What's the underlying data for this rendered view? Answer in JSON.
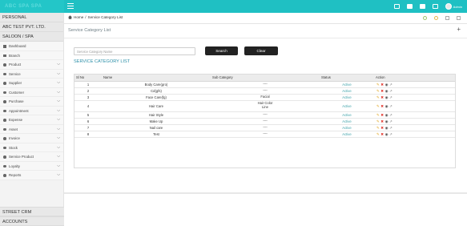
{
  "topbar": {
    "brand": "ABC SPA SPA",
    "user_name": "Admin",
    "icons": [
      "card-icon",
      "chat-icon",
      "bell-icon",
      "user-icon"
    ]
  },
  "sidebar": {
    "sections_top": [
      "PERSONAL",
      "ABC TEST PVT. LTD.",
      "SALOON / SPA"
    ],
    "items": [
      {
        "label": "Dashboard",
        "icon": "dashboard-icon",
        "has_chevron": false
      },
      {
        "label": "Branch",
        "icon": "branch-icon",
        "has_chevron": false
      },
      {
        "label": "Product",
        "icon": "product-icon",
        "has_chevron": true
      },
      {
        "label": "Service",
        "icon": "service-icon",
        "has_chevron": true
      },
      {
        "label": "Supplier",
        "icon": "supplier-icon",
        "has_chevron": true
      },
      {
        "label": "Customer",
        "icon": "customer-icon",
        "has_chevron": true
      },
      {
        "label": "Purchase",
        "icon": "purchase-icon",
        "has_chevron": true
      },
      {
        "label": "Appointment",
        "icon": "appointment-icon",
        "has_chevron": true
      },
      {
        "label": "Expense",
        "icon": "expense-icon",
        "has_chevron": true
      },
      {
        "label": "Asset",
        "icon": "asset-icon",
        "has_chevron": true
      },
      {
        "label": "Invoice",
        "icon": "invoice-icon",
        "has_chevron": true
      },
      {
        "label": "Stock",
        "icon": "stock-icon",
        "has_chevron": true
      },
      {
        "label": "Service Product",
        "icon": "service-product-icon",
        "has_chevron": true
      },
      {
        "label": "Loyalty",
        "icon": "loyalty-icon",
        "has_chevron": true
      },
      {
        "label": "Reports",
        "icon": "reports-icon",
        "has_chevron": true
      }
    ],
    "sections_bottom": [
      "STREET CRM",
      "ACCOUNTS"
    ]
  },
  "breadcrumb": {
    "home": "Home",
    "separator": "/",
    "current": "Service Category List"
  },
  "page_title": "Service Category List",
  "search": {
    "placeholder": "Service Category Name",
    "value": "",
    "search_label": "Search",
    "clear_label": "Clear"
  },
  "list_title": "SERVICE CATEGORY LIST",
  "table": {
    "headers": [
      "Sl No",
      "Name",
      "Sub Category",
      "Status",
      "Action"
    ],
    "rows": [
      {
        "sl": "1",
        "name": "Body Care(gro)",
        "sub": [
          "----"
        ],
        "status": "Active"
      },
      {
        "sl": "2",
        "name": "Cd(gfs)",
        "sub": [
          "----"
        ],
        "status": "Active"
      },
      {
        "sl": "3",
        "name": "Face Care(fg)",
        "sub": [
          "Facial"
        ],
        "status": "Active"
      },
      {
        "sl": "4",
        "name": "Hair Care",
        "sub": [
          "Hair Color",
          "Line"
        ],
        "status": "Active"
      },
      {
        "sl": "5",
        "name": "Hair Style",
        "sub": [
          "----"
        ],
        "status": "Active"
      },
      {
        "sl": "6",
        "name": "Make Up",
        "sub": [
          "----"
        ],
        "status": "Active"
      },
      {
        "sl": "7",
        "name": "Nail care",
        "sub": [
          "----"
        ],
        "status": "Active"
      },
      {
        "sl": "8",
        "name": "Test",
        "sub": [
          "----"
        ],
        "status": "Active"
      }
    ],
    "action_icons": [
      "edit-icon",
      "delete-icon",
      "view-icon",
      "external-link-icon"
    ]
  },
  "colors": {
    "topbar": "#1fc0c3",
    "accent_text": "#2c8fa8",
    "status_active": "#3aa0a8",
    "button": "#222222"
  }
}
